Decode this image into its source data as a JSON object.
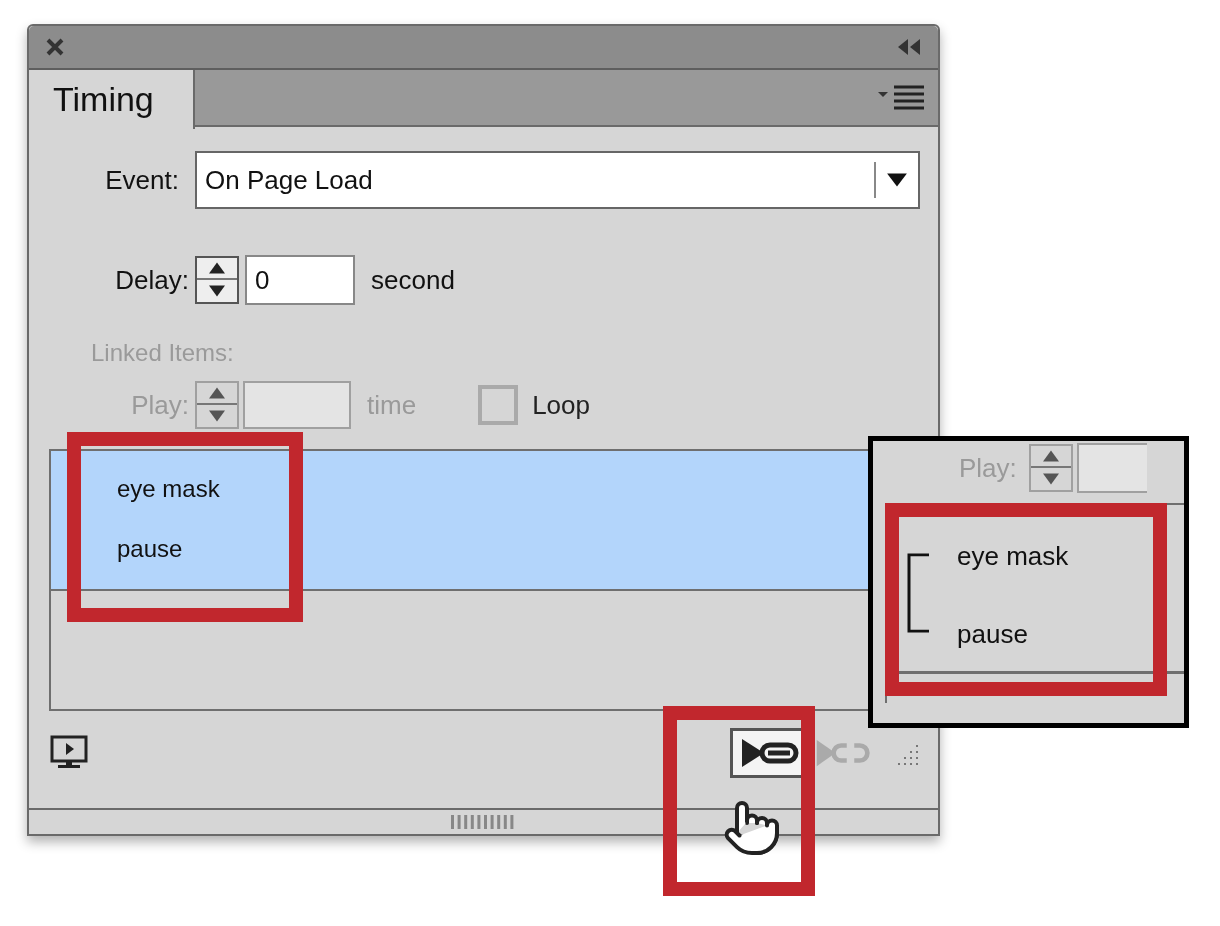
{
  "panel": {
    "tabs": [
      {
        "label": "Timing",
        "selected": true
      }
    ],
    "event": {
      "label": "Event:",
      "value": "On Page Load"
    },
    "delay": {
      "label": "Delay:",
      "value": "0",
      "unit": "second"
    },
    "linked_items": {
      "label": "Linked Items:",
      "disabled": true
    },
    "play": {
      "label": "Play:",
      "unit": "time",
      "disabled": true
    },
    "loop": {
      "label": "Loop",
      "checked": false,
      "disabled": true
    },
    "list": [
      {
        "label": "eye mask",
        "selected": true
      },
      {
        "label": "pause",
        "selected": true
      }
    ],
    "footer_buttons": [
      {
        "kind": "preview",
        "disabled": false
      },
      {
        "kind": "link",
        "disabled": false
      },
      {
        "kind": "unlink",
        "disabled": true
      }
    ]
  },
  "callout": {
    "play_label": "Play:",
    "items": [
      {
        "label": "eye mask"
      },
      {
        "label": "pause"
      }
    ]
  }
}
